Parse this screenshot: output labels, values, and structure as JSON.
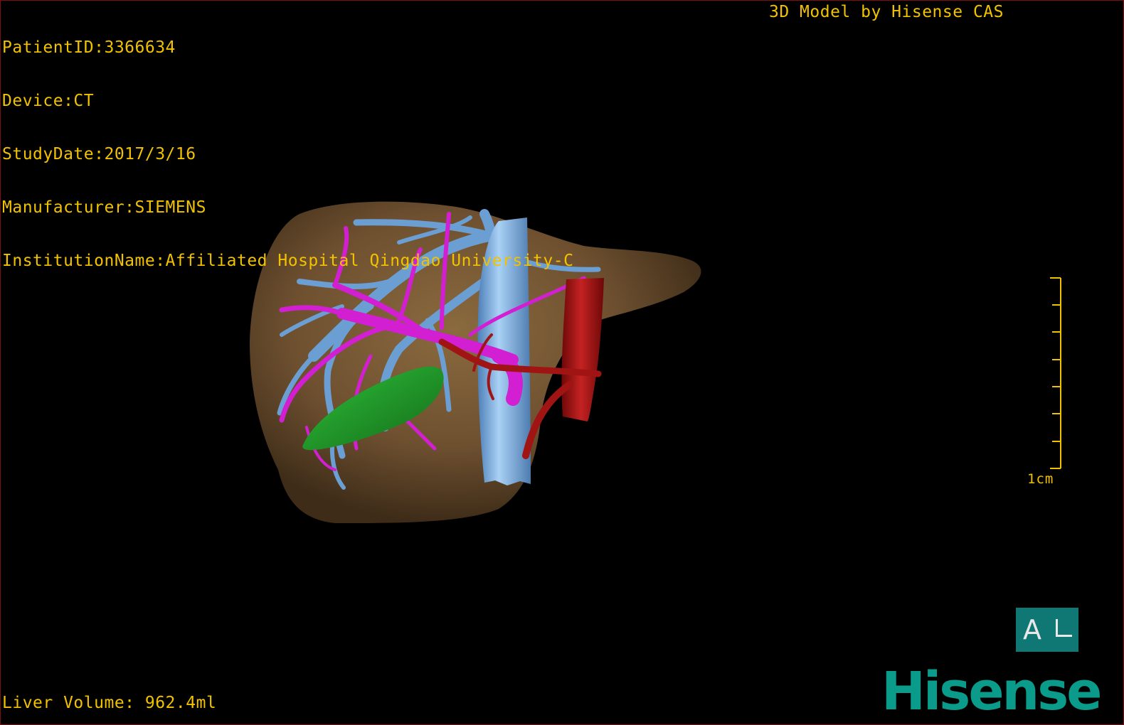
{
  "info": {
    "patient_id": "PatientID:3366634",
    "device": "Device:CT",
    "study_date": "StudyDate:2017/3/16",
    "manufacturer": "Manufacturer:SIEMENS",
    "institution": "InstitutionName:Affiliated Hospital Qingdao University-C"
  },
  "credit": "3D Model by Hisense CAS",
  "liver_volume": "Liver Volume: 962.4ml",
  "scale": {
    "label": "1cm"
  },
  "orientation": {
    "label": "A"
  },
  "brand": "Hisense",
  "colors": {
    "overlay_text": "#f2c200",
    "liver": "#6b4e2a",
    "portal_vein": "#d21fd2",
    "hepatic_vein": "#6b9fd4",
    "ivc": "#7fb3e6",
    "artery": "#a01414",
    "gallbladder": "#1e9a28",
    "brand": "#0a9b8a",
    "orientation_cube": "#0f7774"
  },
  "structures": [
    "liver",
    "hepatic-veins",
    "portal-veins",
    "inferior-vena-cava",
    "aorta",
    "gallbladder"
  ]
}
